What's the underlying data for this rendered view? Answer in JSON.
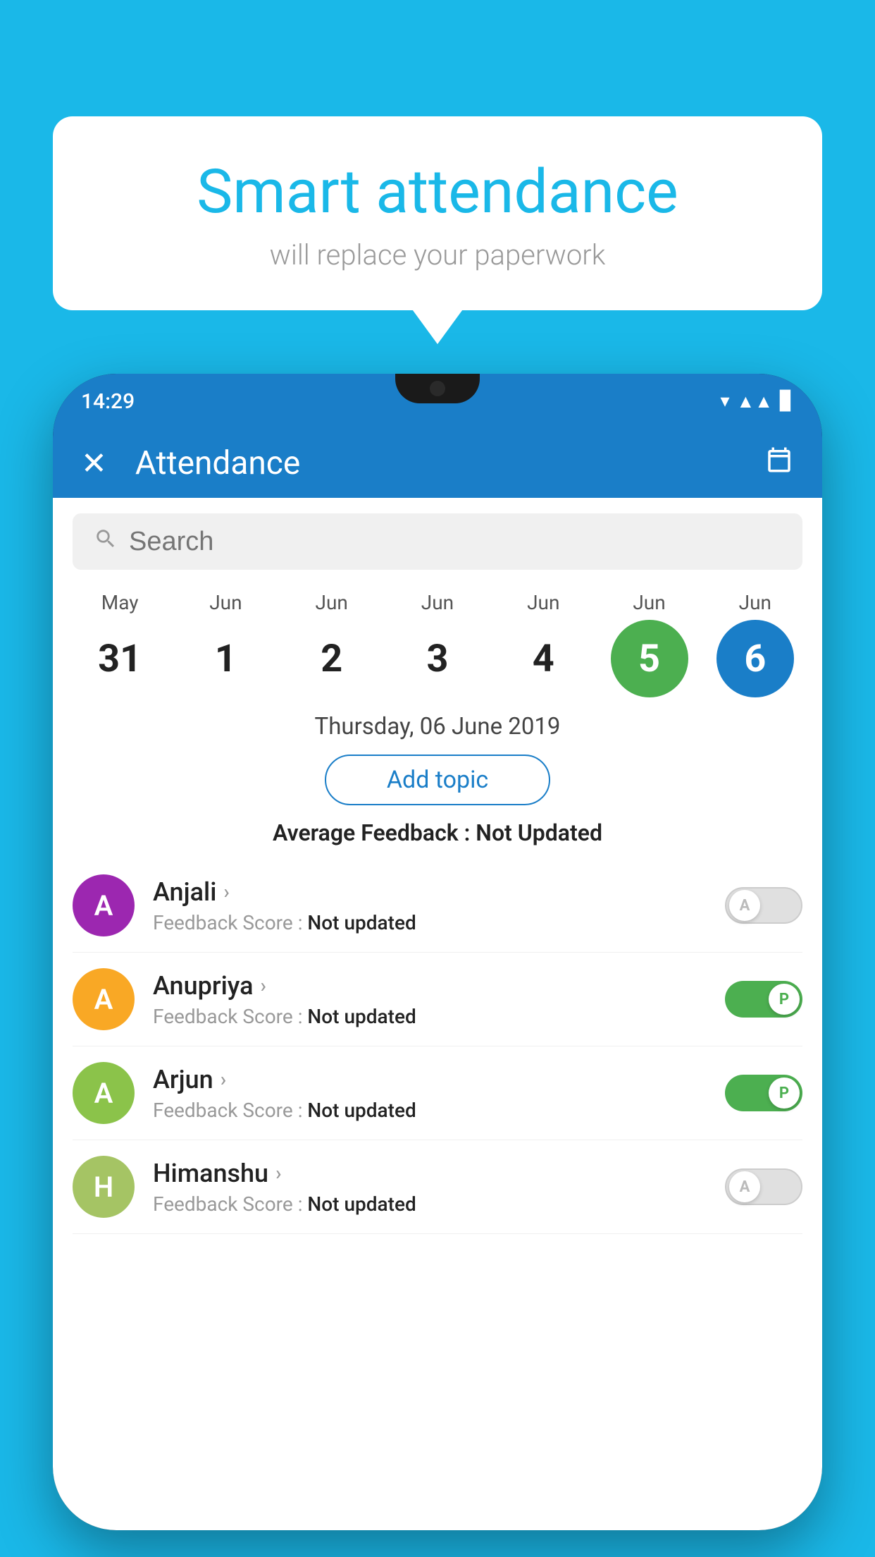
{
  "background_color": "#1ab8e8",
  "bubble": {
    "title": "Smart attendance",
    "subtitle": "will replace your paperwork"
  },
  "phone": {
    "status_time": "14:29",
    "header": {
      "title": "Attendance",
      "close_label": "✕",
      "calendar_icon": "📅"
    },
    "search": {
      "placeholder": "Search"
    },
    "dates": [
      {
        "month": "May",
        "day": "31",
        "active": false,
        "color": ""
      },
      {
        "month": "Jun",
        "day": "1",
        "active": false,
        "color": ""
      },
      {
        "month": "Jun",
        "day": "2",
        "active": false,
        "color": ""
      },
      {
        "month": "Jun",
        "day": "3",
        "active": false,
        "color": ""
      },
      {
        "month": "Jun",
        "day": "4",
        "active": false,
        "color": ""
      },
      {
        "month": "Jun",
        "day": "5",
        "active": true,
        "color": "green"
      },
      {
        "month": "Jun",
        "day": "6",
        "active": true,
        "color": "blue"
      }
    ],
    "selected_date": "Thursday, 06 June 2019",
    "add_topic_label": "Add topic",
    "avg_feedback_label": "Average Feedback :",
    "avg_feedback_value": "Not Updated",
    "students": [
      {
        "name": "Anjali",
        "avatar_letter": "A",
        "avatar_color": "#9c27b0",
        "feedback_label": "Feedback Score :",
        "feedback_value": "Not updated",
        "toggle": "off",
        "toggle_letter": "A"
      },
      {
        "name": "Anupriya",
        "avatar_letter": "A",
        "avatar_color": "#f9a825",
        "feedback_label": "Feedback Score :",
        "feedback_value": "Not updated",
        "toggle": "on",
        "toggle_letter": "P"
      },
      {
        "name": "Arjun",
        "avatar_letter": "A",
        "avatar_color": "#8bc34a",
        "feedback_label": "Feedback Score :",
        "feedback_value": "Not updated",
        "toggle": "on",
        "toggle_letter": "P"
      },
      {
        "name": "Himanshu",
        "avatar_letter": "H",
        "avatar_color": "#a5c464",
        "feedback_label": "Feedback Score :",
        "feedback_value": "Not updated",
        "toggle": "off",
        "toggle_letter": "A"
      }
    ]
  }
}
